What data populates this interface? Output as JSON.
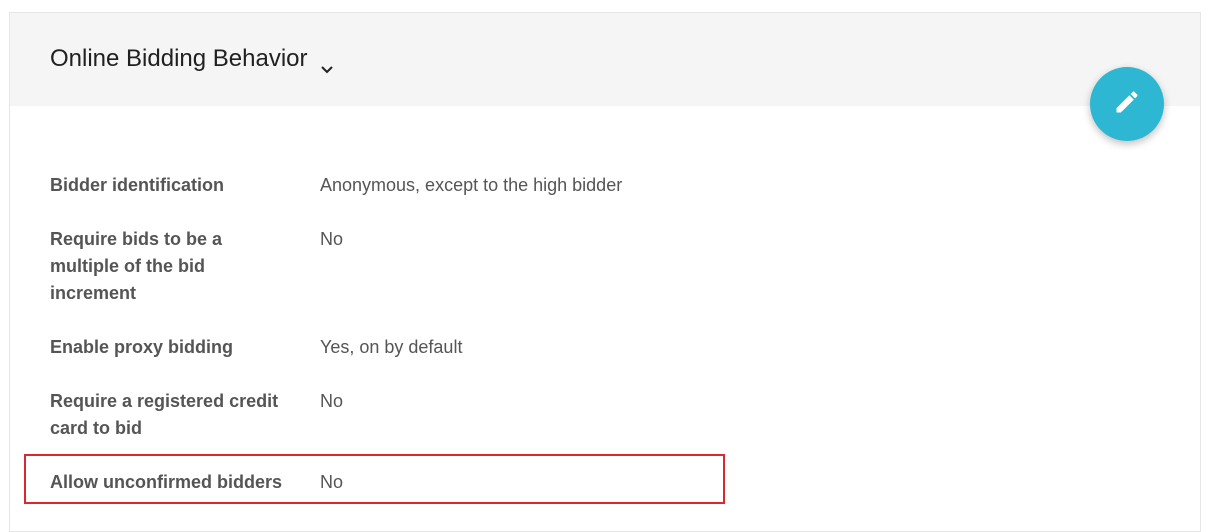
{
  "section": {
    "title": "Online Bidding Behavior",
    "edit_button_icon": "pencil-icon"
  },
  "settings": [
    {
      "label": "Bidder identification",
      "value": "Anonymous, except to the high bidder"
    },
    {
      "label": "Require bids to be a multiple of the bid increment",
      "value": "No"
    },
    {
      "label": "Enable proxy bidding",
      "value": "Yes, on by default"
    },
    {
      "label": "Require a registered credit card to bid",
      "value": "No"
    },
    {
      "label": "Allow unconfirmed bidders",
      "value": "No"
    }
  ],
  "colors": {
    "header_bg": "#f5f5f5",
    "fab_bg": "#2db7d3",
    "highlight_border": "#d9282f",
    "text": "#555555"
  }
}
